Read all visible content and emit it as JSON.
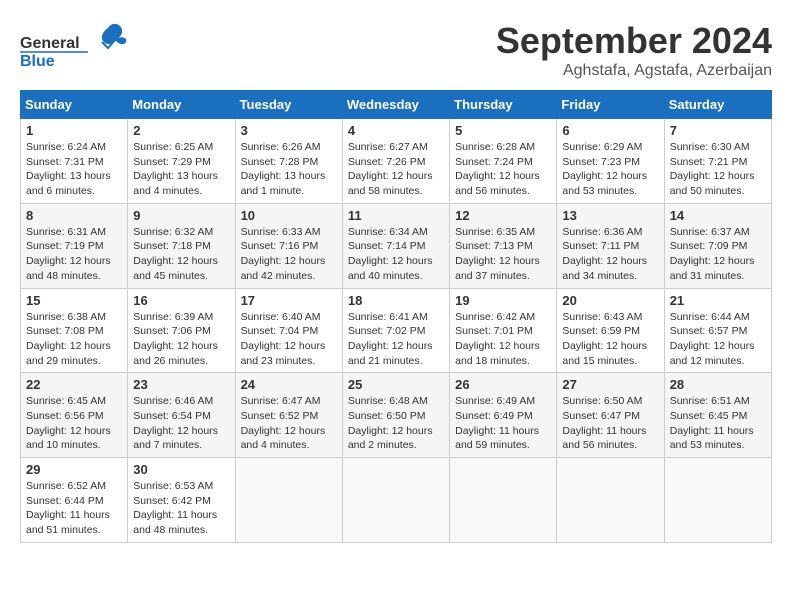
{
  "header": {
    "logo_general": "General",
    "logo_blue": "Blue",
    "title": "September 2024",
    "location": "Aghstafa, Agstafa, Azerbaijan"
  },
  "days_of_week": [
    "Sunday",
    "Monday",
    "Tuesday",
    "Wednesday",
    "Thursday",
    "Friday",
    "Saturday"
  ],
  "weeks": [
    [
      {
        "day": "1",
        "sunrise": "6:24 AM",
        "sunset": "7:31 PM",
        "daylight": "13 hours and 6 minutes."
      },
      {
        "day": "2",
        "sunrise": "6:25 AM",
        "sunset": "7:29 PM",
        "daylight": "13 hours and 4 minutes."
      },
      {
        "day": "3",
        "sunrise": "6:26 AM",
        "sunset": "7:28 PM",
        "daylight": "13 hours and 1 minute."
      },
      {
        "day": "4",
        "sunrise": "6:27 AM",
        "sunset": "7:26 PM",
        "daylight": "12 hours and 58 minutes."
      },
      {
        "day": "5",
        "sunrise": "6:28 AM",
        "sunset": "7:24 PM",
        "daylight": "12 hours and 56 minutes."
      },
      {
        "day": "6",
        "sunrise": "6:29 AM",
        "sunset": "7:23 PM",
        "daylight": "12 hours and 53 minutes."
      },
      {
        "day": "7",
        "sunrise": "6:30 AM",
        "sunset": "7:21 PM",
        "daylight": "12 hours and 50 minutes."
      }
    ],
    [
      {
        "day": "8",
        "sunrise": "6:31 AM",
        "sunset": "7:19 PM",
        "daylight": "12 hours and 48 minutes."
      },
      {
        "day": "9",
        "sunrise": "6:32 AM",
        "sunset": "7:18 PM",
        "daylight": "12 hours and 45 minutes."
      },
      {
        "day": "10",
        "sunrise": "6:33 AM",
        "sunset": "7:16 PM",
        "daylight": "12 hours and 42 minutes."
      },
      {
        "day": "11",
        "sunrise": "6:34 AM",
        "sunset": "7:14 PM",
        "daylight": "12 hours and 40 minutes."
      },
      {
        "day": "12",
        "sunrise": "6:35 AM",
        "sunset": "7:13 PM",
        "daylight": "12 hours and 37 minutes."
      },
      {
        "day": "13",
        "sunrise": "6:36 AM",
        "sunset": "7:11 PM",
        "daylight": "12 hours and 34 minutes."
      },
      {
        "day": "14",
        "sunrise": "6:37 AM",
        "sunset": "7:09 PM",
        "daylight": "12 hours and 31 minutes."
      }
    ],
    [
      {
        "day": "15",
        "sunrise": "6:38 AM",
        "sunset": "7:08 PM",
        "daylight": "12 hours and 29 minutes."
      },
      {
        "day": "16",
        "sunrise": "6:39 AM",
        "sunset": "7:06 PM",
        "daylight": "12 hours and 26 minutes."
      },
      {
        "day": "17",
        "sunrise": "6:40 AM",
        "sunset": "7:04 PM",
        "daylight": "12 hours and 23 minutes."
      },
      {
        "day": "18",
        "sunrise": "6:41 AM",
        "sunset": "7:02 PM",
        "daylight": "12 hours and 21 minutes."
      },
      {
        "day": "19",
        "sunrise": "6:42 AM",
        "sunset": "7:01 PM",
        "daylight": "12 hours and 18 minutes."
      },
      {
        "day": "20",
        "sunrise": "6:43 AM",
        "sunset": "6:59 PM",
        "daylight": "12 hours and 15 minutes."
      },
      {
        "day": "21",
        "sunrise": "6:44 AM",
        "sunset": "6:57 PM",
        "daylight": "12 hours and 12 minutes."
      }
    ],
    [
      {
        "day": "22",
        "sunrise": "6:45 AM",
        "sunset": "6:56 PM",
        "daylight": "12 hours and 10 minutes."
      },
      {
        "day": "23",
        "sunrise": "6:46 AM",
        "sunset": "6:54 PM",
        "daylight": "12 hours and 7 minutes."
      },
      {
        "day": "24",
        "sunrise": "6:47 AM",
        "sunset": "6:52 PM",
        "daylight": "12 hours and 4 minutes."
      },
      {
        "day": "25",
        "sunrise": "6:48 AM",
        "sunset": "6:50 PM",
        "daylight": "12 hours and 2 minutes."
      },
      {
        "day": "26",
        "sunrise": "6:49 AM",
        "sunset": "6:49 PM",
        "daylight": "11 hours and 59 minutes."
      },
      {
        "day": "27",
        "sunrise": "6:50 AM",
        "sunset": "6:47 PM",
        "daylight": "11 hours and 56 minutes."
      },
      {
        "day": "28",
        "sunrise": "6:51 AM",
        "sunset": "6:45 PM",
        "daylight": "11 hours and 53 minutes."
      }
    ],
    [
      {
        "day": "29",
        "sunrise": "6:52 AM",
        "sunset": "6:44 PM",
        "daylight": "11 hours and 51 minutes."
      },
      {
        "day": "30",
        "sunrise": "6:53 AM",
        "sunset": "6:42 PM",
        "daylight": "11 hours and 48 minutes."
      },
      null,
      null,
      null,
      null,
      null
    ]
  ]
}
